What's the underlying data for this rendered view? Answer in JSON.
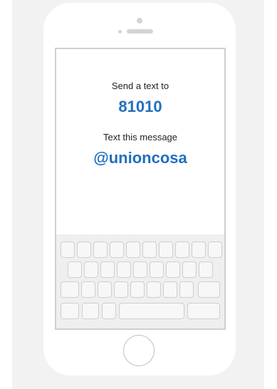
{
  "instructions": {
    "line1": "Send a text to",
    "number": "81010",
    "line2": "Text this message",
    "message": "@unioncosa"
  },
  "colors": {
    "accent": "#1f6fbf",
    "text": "#222222",
    "panel_bg": "#f2f2f2",
    "phone_outline": "#cfcfcf"
  },
  "icons": {
    "camera": "camera-dot-icon",
    "sensor": "sensor-dot-icon",
    "speaker": "speaker-grille-icon",
    "home": "home-button-icon"
  }
}
